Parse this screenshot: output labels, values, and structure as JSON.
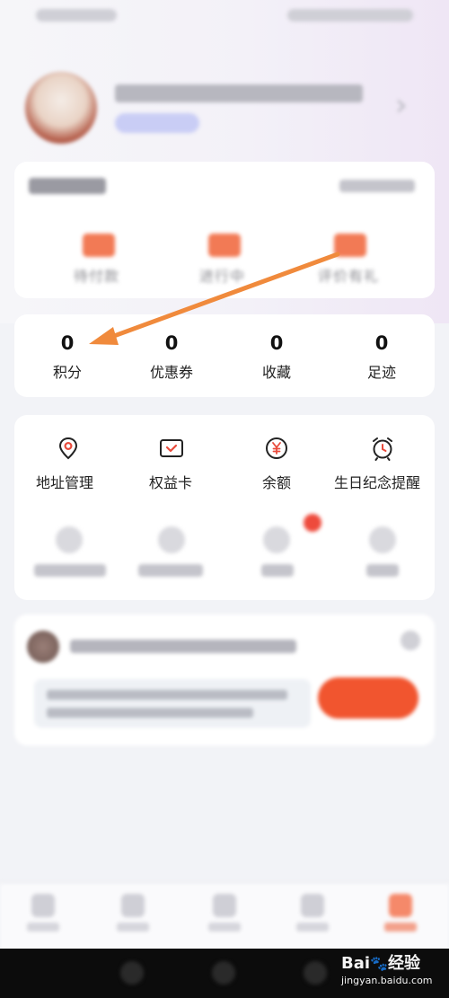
{
  "stats": [
    {
      "value": "0",
      "label": "积分"
    },
    {
      "value": "0",
      "label": "优惠券"
    },
    {
      "value": "0",
      "label": "收藏"
    },
    {
      "value": "0",
      "label": "足迹"
    }
  ],
  "orders": {
    "items": [
      {
        "label": "待付款"
      },
      {
        "label": "进行中"
      },
      {
        "label": "评价有礼"
      }
    ]
  },
  "tools": {
    "items": [
      {
        "label": "地址管理",
        "icon": "location-pin-icon"
      },
      {
        "label": "权益卡",
        "icon": "benefit-card-icon"
      },
      {
        "label": "余额",
        "icon": "yuan-coin-icon"
      },
      {
        "label": "生日纪念提醒",
        "icon": "alarm-clock-icon"
      }
    ]
  },
  "watermark": {
    "brand": "Bai",
    "brand_suffix": "经验",
    "site": "jingyan.baidu.com"
  },
  "colors": {
    "accent": "#f1552f",
    "annotation_arrow": "#f08a3c"
  }
}
